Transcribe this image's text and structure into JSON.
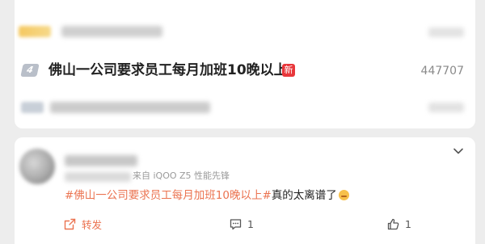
{
  "hot_list": {
    "item": {
      "rank": "4",
      "title": "佛山一公司要求员工每月加班10晚以上",
      "badge": "新",
      "heat": "447707"
    }
  },
  "post": {
    "meta": "来自 iQOO Z5 性能先锋",
    "hashtag": "#佛山一公司要求员工每月加班10晚以上#",
    "text": "真的太离谱了",
    "actions": {
      "forward_label": "转发",
      "comment_count": "1",
      "like_count": "1"
    }
  },
  "colors": {
    "accent": "#eb7350",
    "new_badge": "#e8373b",
    "background": "#ededed"
  }
}
